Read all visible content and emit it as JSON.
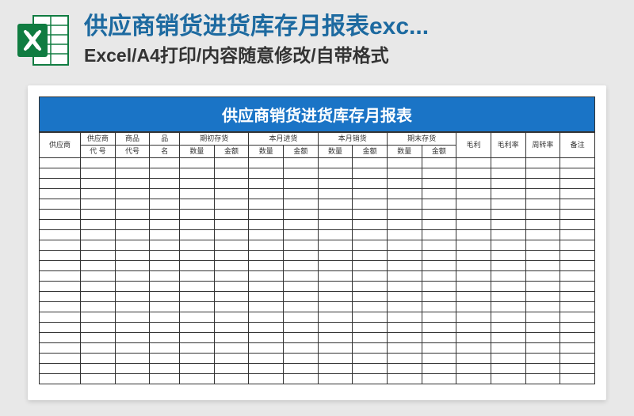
{
  "header": {
    "title": "供应商销货进货库存月报表exc...",
    "subtitle": "Excel/A4打印/内容随意修改/自带格式"
  },
  "sheet": {
    "title": "供应商销货进货库存月报表",
    "columns": {
      "supplier": "供应商",
      "supplier_code_line1": "供应商",
      "supplier_code_line2": "代 号",
      "product_code_line1": "商品",
      "product_code_line2": "代号",
      "product_name_line1": "品",
      "product_name_line2": "名",
      "groups": [
        {
          "label": "期初存货",
          "sub": [
            "数量",
            "金额"
          ]
        },
        {
          "label": "本月进货",
          "sub": [
            "数量",
            "金额"
          ]
        },
        {
          "label": "本月销货",
          "sub": [
            "数量",
            "金额"
          ]
        },
        {
          "label": "期末存货",
          "sub": [
            "数量",
            "金额"
          ]
        }
      ],
      "gross_profit": "毛利",
      "gross_profit_rate": "毛利率",
      "turnover_rate": "周转率",
      "remark": "备注"
    },
    "empty_row_count": 22
  },
  "colors": {
    "accent": "#1d6aa0",
    "sheet_header": "#1a74c6",
    "excel_green": "#107c41"
  }
}
